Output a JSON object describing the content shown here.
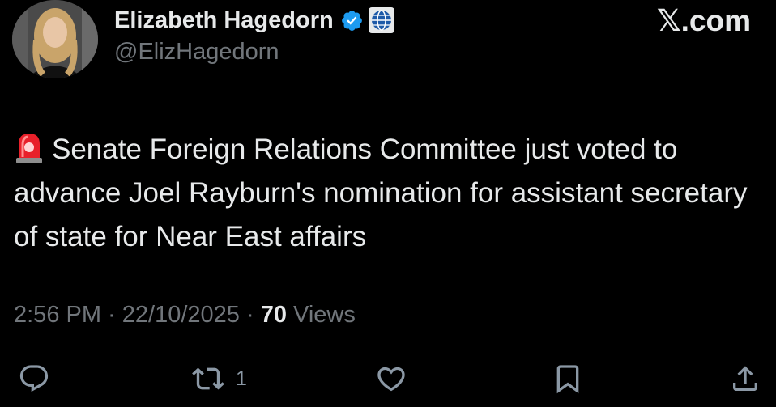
{
  "author": {
    "display_name": "Elizabeth Hagedorn",
    "handle": "@ElizHagedorn",
    "verified": true
  },
  "site": {
    "logo_text": "𝕏.com"
  },
  "post": {
    "emoji": "siren-icon",
    "text": "Senate Foreign Relations Committee just voted to advance Joel Rayburn's nomination for assistant secretary of state for Near East affairs"
  },
  "meta": {
    "time": "2:56 PM",
    "separator": " · ",
    "date": "22/10/2025",
    "views_count": "70",
    "views_label": "Views"
  },
  "actions": {
    "reply": {
      "icon": "reply-icon"
    },
    "repost": {
      "icon": "repost-icon",
      "count": "1"
    },
    "like": {
      "icon": "heart-icon"
    },
    "bookmark": {
      "icon": "bookmark-icon"
    },
    "share": {
      "icon": "share-icon"
    }
  },
  "colors": {
    "background": "#000000",
    "text_primary": "#e7e9ea",
    "text_secondary": "#71767b",
    "verified_blue": "#1d9bf0"
  }
}
